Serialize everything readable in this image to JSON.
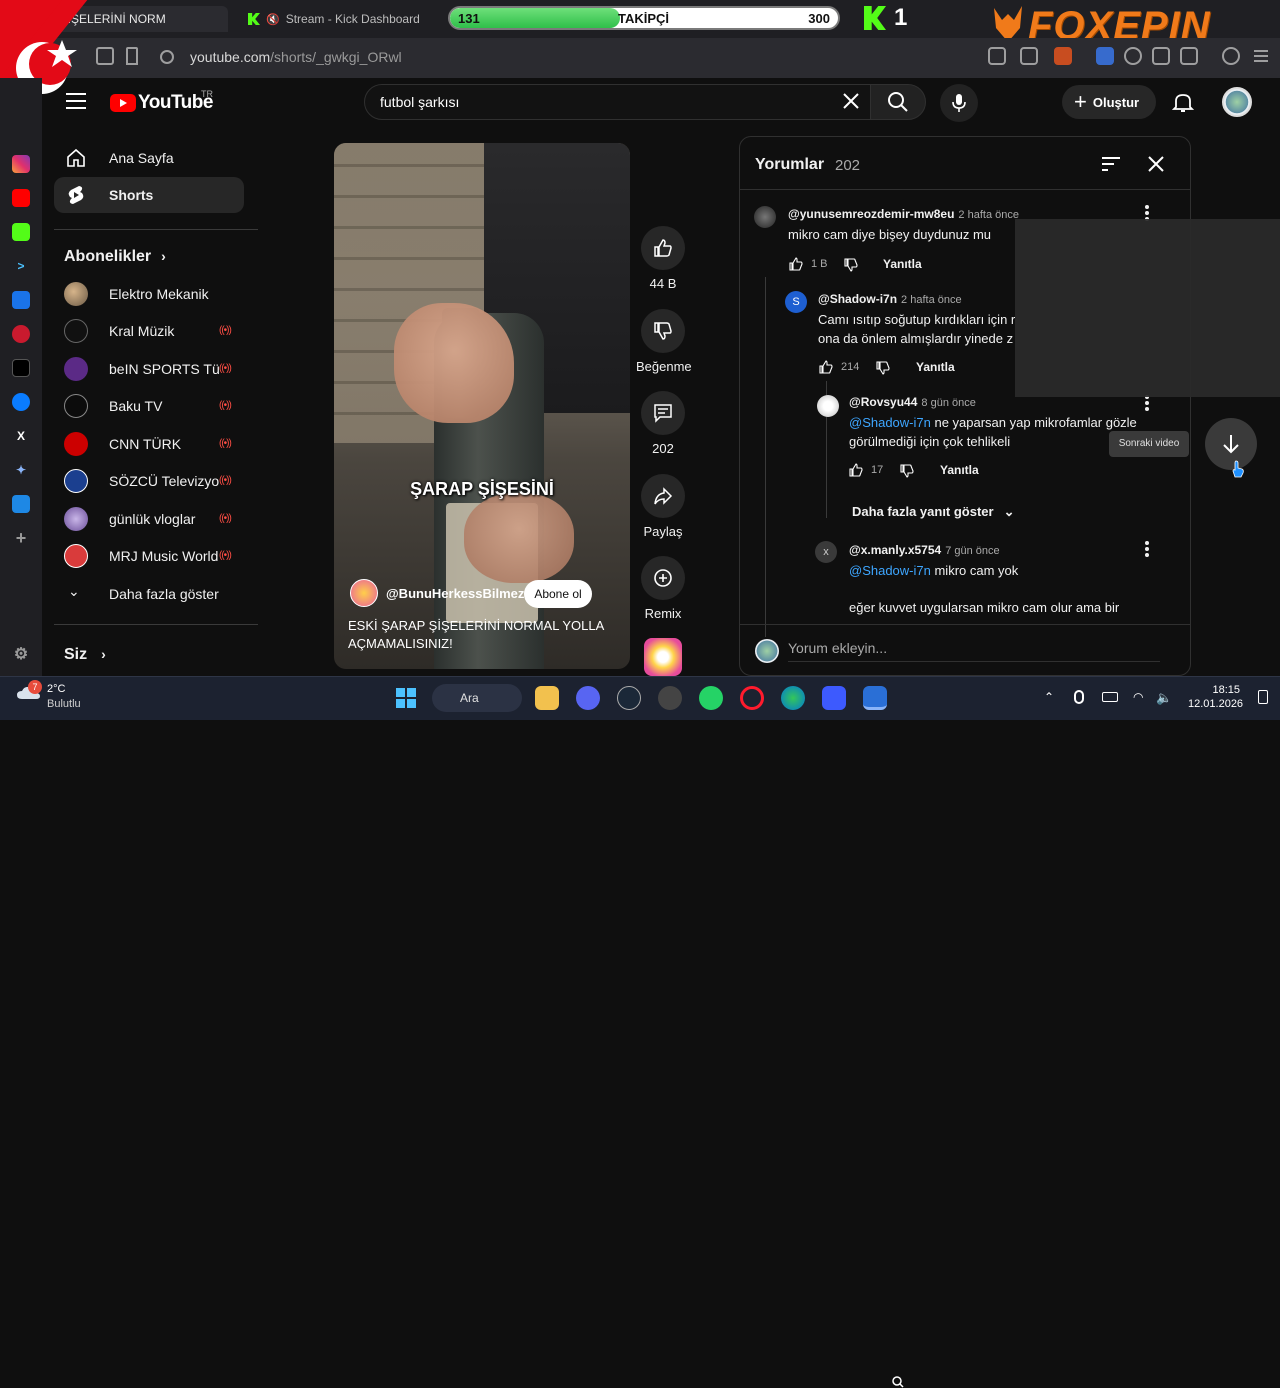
{
  "browser": {
    "tabs": [
      {
        "label": "ŞİŞELERİNİ NORM"
      },
      {
        "label": "Stream - Kick Dashboard"
      }
    ],
    "url_domain": "youtube.com",
    "url_path": "/shorts/_gwkgi_ORwl"
  },
  "overlay": {
    "follow_current": "131",
    "follow_label": "TAKİPÇİ",
    "follow_goal": "300",
    "follow_progress": 0.437,
    "kick_count": "1",
    "brand": "FOXEPIN"
  },
  "header": {
    "logo_text": "YouTube",
    "country": "TR",
    "search_value": "futbol şarkısı",
    "create_label": "Oluştur"
  },
  "nav": {
    "home": "Ana Sayfa",
    "shorts": "Shorts",
    "subs_title": "Abonelikler",
    "subscriptions": [
      {
        "name": "Elektro Mekanik",
        "live": ""
      },
      {
        "name": "Kral Müzik",
        "live": "((•))"
      },
      {
        "name": "beIN SPORTS Tü...",
        "live": "((•))"
      },
      {
        "name": "Baku TV",
        "live": "((•))"
      },
      {
        "name": "CNN TÜRK",
        "live": "((•))"
      },
      {
        "name": "SÖZCÜ Televizyo...",
        "live": "((•))"
      },
      {
        "name": "günlük vloglar",
        "live": "((•))"
      },
      {
        "name": "MRJ Music World",
        "live": "((•))"
      }
    ],
    "show_more": "Daha fazla göster",
    "you": "Siz"
  },
  "video": {
    "caption": "ŞARAP ŞİŞESİNİ",
    "channel": "@BunuHerkessBilmez",
    "subscribe": "Abone ol",
    "title": "ESKİ ŞARAP ŞİŞELERİNİ NORMAL YOLLA AÇMAMALISINIZ!"
  },
  "actions": {
    "likes": "44 B",
    "dislike": "Beğenme",
    "comments": "202",
    "share": "Paylaş",
    "remix": "Remix"
  },
  "comments": {
    "title": "Yorumlar",
    "count": "202",
    "reply_label": "Yanıtla",
    "items": [
      {
        "user": "@yunusemreozdemir-mw8eu",
        "time": "2 hafta önce",
        "text": "mikro cam diye bişey duydunuz mu",
        "likes": "1 B"
      },
      {
        "user": "@Shadow-i7n",
        "time": "2 hafta önce",
        "text1": "Camı ısıtıp soğutup kırdıkları için r",
        "text2": "ona da önlem almışlardır yinede z",
        "likes": "214",
        "avatar": "S"
      },
      {
        "user": "@Rovsyu44",
        "time": "8 gün önce",
        "mention": "@Shadow-i7n",
        "text1": " ne yaparsan yap mikrofamlar gözle",
        "text2": "görülmediği için çok tehlikeli",
        "likes": "17"
      },
      {
        "user": "@x.manly.x5754",
        "time": "7 gün önce",
        "mention": "@Shadow-i7n",
        "text1": "  mikro cam yok",
        "text2": "eğer kuvvet uygularsan mikro cam olur ama bir",
        "avatar": "x"
      }
    ],
    "more_replies": "Daha fazla yanıt göster",
    "input_placeholder": "Yorum ekleyin..."
  },
  "next_video_tip": "Sonraki video",
  "taskbar": {
    "temp": "2°C",
    "condition": "Bulutlu",
    "weather_badge": "7",
    "search": "Ara",
    "time": "18:15",
    "date": "12.01.2026"
  }
}
